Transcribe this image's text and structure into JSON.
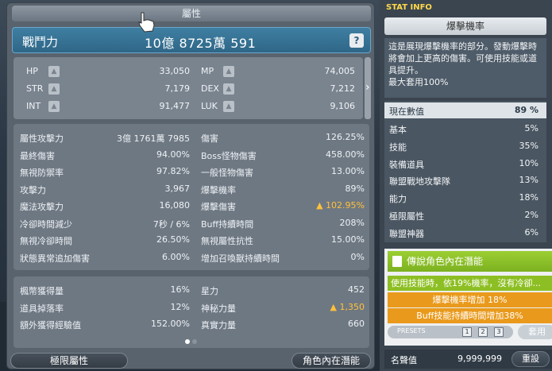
{
  "stat_window": {
    "title": "屬性",
    "combat_power": {
      "label": "戰鬥力",
      "value": "10億 8725萬 591",
      "help": "?"
    },
    "base_stats": [
      {
        "label": "HP",
        "value": "33,050"
      },
      {
        "label": "MP",
        "value": "74,005"
      },
      {
        "label": "STR",
        "value": "7,179"
      },
      {
        "label": "DEX",
        "value": "7,212"
      },
      {
        "label": "INT",
        "value": "91,477"
      },
      {
        "label": "LUK",
        "value": "9,106"
      }
    ],
    "detail_stats": [
      {
        "l1": "屬性攻擊力",
        "v1": "3億 1761萬 7985",
        "l2": "傷害",
        "v2": "126.25%"
      },
      {
        "l1": "最終傷害",
        "v1": "94.00%",
        "l2": "Boss怪物傷害",
        "v2": "458.00%"
      },
      {
        "l1": "無視防禦率",
        "v1": "97.82%",
        "l2": "一般怪物傷害",
        "v2": "13.00%"
      },
      {
        "l1": "攻擊力",
        "v1": "3,967",
        "l2": "爆擊機率",
        "v2": "89%"
      },
      {
        "l1": "魔法攻擊力",
        "v1": "16,080",
        "l2": "爆擊傷害",
        "v2": "▲ 102.95%"
      },
      {
        "l1": "冷卻時間減少",
        "v1": "7秒 / 6%",
        "l2": "Buff持續時間",
        "v2": "208%"
      },
      {
        "l1": "無視冷卻時間",
        "v1": "26.50%",
        "l2": "無視屬性抗性",
        "v2": "15.00%"
      },
      {
        "l1": "狀態異常追加傷害",
        "v1": "6.00%",
        "l2": "增加召喚獸持續時間",
        "v2": "0%"
      }
    ],
    "extra_stats": [
      {
        "l1": "楓幣獲得量",
        "v1": "16%",
        "l2": "星力",
        "v2": "452"
      },
      {
        "l1": "道具掉落率",
        "v1": "12%",
        "l2": "神秘力量",
        "v2": "▲ 1,350"
      },
      {
        "l1": "額外獲得經驗值",
        "v1": "152.00%",
        "l2": "真實力量",
        "v2": "660"
      }
    ],
    "buttons": {
      "hyper_stat": "極限屬性",
      "ability": "角色內在潛能"
    },
    "page_indicator": {
      "current": 1,
      "total": 2
    }
  },
  "stat_info": {
    "header": "STAT INFO",
    "title": "爆擊機率",
    "description": "這是展現爆擊機率的部分。發動爆擊時將會加上更高的傷害。可使用技能或道具提升。\n最大套用100%",
    "current": {
      "label": "現在數值",
      "value": "89 %"
    },
    "rows": [
      {
        "label": "基本",
        "value": "5%"
      },
      {
        "label": "技能",
        "value": "35%"
      },
      {
        "label": "裝備道具",
        "value": "10%"
      },
      {
        "label": "聯盟戰地攻擊隊",
        "value": "13%"
      },
      {
        "label": "能力",
        "value": "18%"
      },
      {
        "label": "極限屬性",
        "value": "2%"
      },
      {
        "label": "聯盟神器",
        "value": "6%"
      }
    ],
    "inner_ability": {
      "title": "傳說角色內在潛能",
      "lines": [
        "使用技能時，依19%機率，沒有冷卻...",
        "爆擊機率增加 18%",
        "Buff技能持續時間增加38%"
      ],
      "presets_label": "PRESETS",
      "presets": [
        "1",
        "2",
        "3"
      ],
      "apply": "套用"
    },
    "fame": {
      "label": "名聲值",
      "value": "9,999,999",
      "reset": "重設"
    }
  },
  "colors": {
    "accent_blue": "#2f6687",
    "up_arrow": "#ffc03a",
    "ability_green": "#8dbf24",
    "ability_orange": "#e99a1c",
    "header_yellow": "#ffd94a"
  }
}
